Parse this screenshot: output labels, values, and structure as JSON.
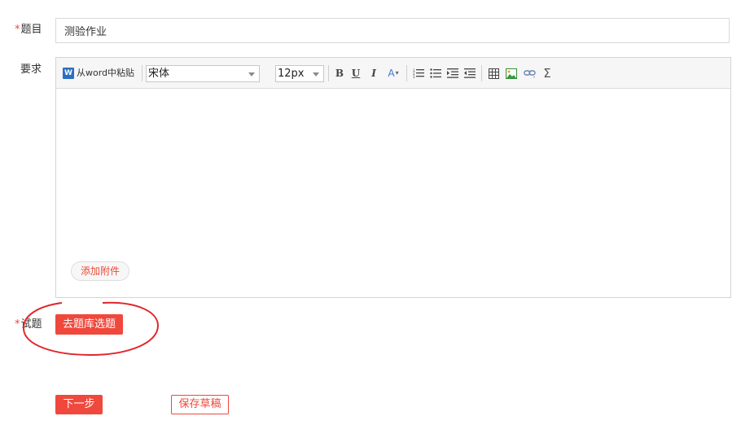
{
  "form": {
    "required_mark": "*",
    "title_label": "题目",
    "title_value": "测验作业",
    "requirement_label": "要求",
    "questions_label": "试题"
  },
  "toolbar": {
    "paste_from_word": "从word中粘贴",
    "word_icon_letter": "W",
    "font_family_value": "宋体",
    "font_size_value": "12px",
    "bold": "B",
    "underline": "U",
    "italic": "I",
    "font_color": "A",
    "icons": [
      "ordered-list-icon",
      "unordered-list-icon",
      "indent-icon",
      "outdent-icon",
      "table-icon",
      "image-icon",
      "link-icon",
      "formula-icon"
    ],
    "formula_glyph": "Σ"
  },
  "editor": {
    "attach_label": "添加附件"
  },
  "actions": {
    "question_bank_label": "去题库选题",
    "next_label": "下一步",
    "save_draft_label": "保存草稿"
  },
  "colors": {
    "accent": "#f0483c",
    "annotation": "#e0262a"
  }
}
